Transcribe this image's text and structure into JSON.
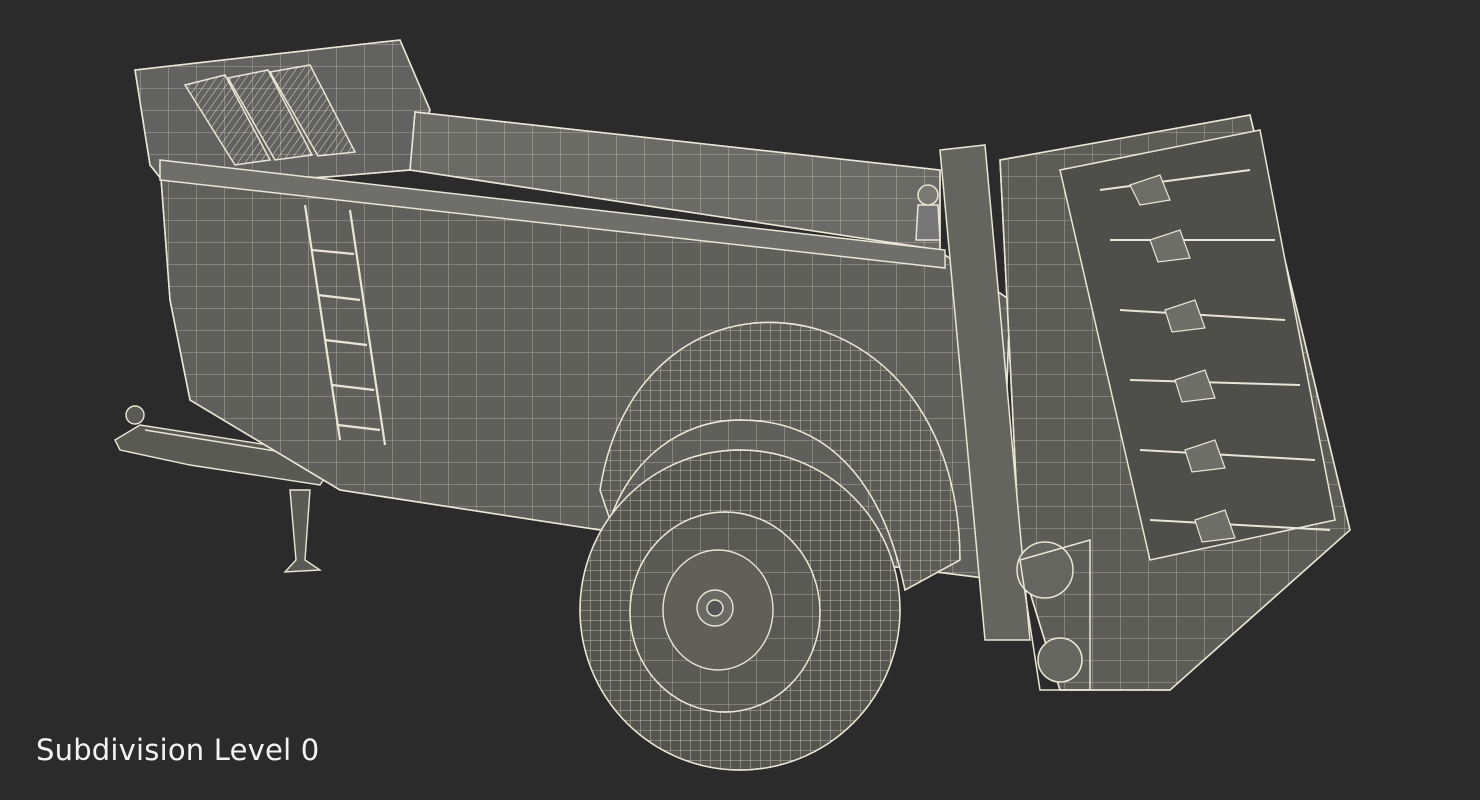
{
  "render": {
    "subject": "manure-spreader-trailer-wireframe",
    "background_color": "#2b2b2b",
    "model_color": "#5e5e58",
    "wire_color": "#e8e6d6"
  },
  "caption": {
    "text": "Subdivision Level 0"
  }
}
